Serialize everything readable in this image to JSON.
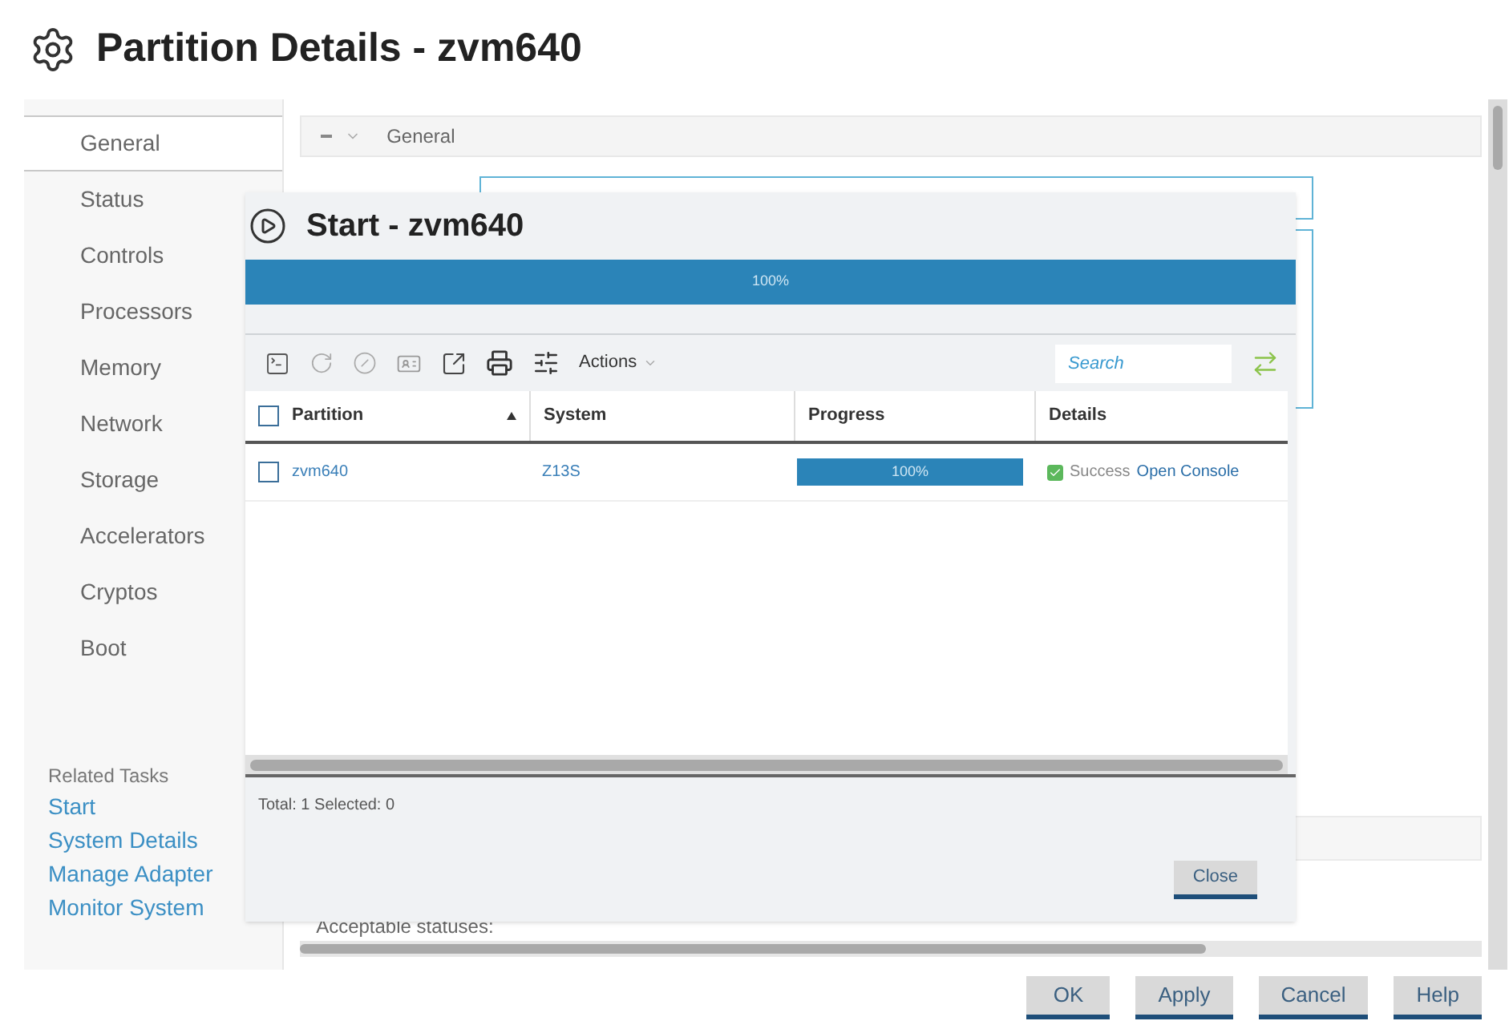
{
  "window": {
    "title": "Partition Details - zvm640"
  },
  "sidebar": {
    "items": [
      {
        "label": "General",
        "selected": true
      },
      {
        "label": "Status",
        "selected": false
      },
      {
        "label": "Controls",
        "selected": false
      },
      {
        "label": "Processors",
        "selected": false
      },
      {
        "label": "Memory",
        "selected": false
      },
      {
        "label": "Network",
        "selected": false
      },
      {
        "label": "Storage",
        "selected": false
      },
      {
        "label": "Accelerators",
        "selected": false
      },
      {
        "label": "Cryptos",
        "selected": false
      },
      {
        "label": "Boot",
        "selected": false
      }
    ],
    "related_tasks": {
      "heading": "Related Tasks",
      "links": [
        "Start",
        "System Details",
        "Manage Adapter",
        "Monitor System"
      ]
    }
  },
  "content": {
    "section": {
      "label": "General",
      "expanded": true
    },
    "acceptable_statuses_label": "Acceptable statuses:"
  },
  "dialog": {
    "title": "Start - zvm640",
    "progress": {
      "level": 1,
      "reading": "100%"
    },
    "toolbar": {
      "actions_label": "Actions",
      "search": {
        "placeholder": "Search"
      }
    },
    "table": {
      "header_checked": false,
      "columns": [
        {
          "label": "Partition",
          "sorted": true
        },
        {
          "label": "System",
          "sorted": false
        },
        {
          "label": "Progress",
          "sorted": false
        },
        {
          "label": "Details",
          "sorted": false
        }
      ],
      "rows": [
        {
          "checked": false,
          "partition": "zvm640",
          "system": "Z13S",
          "progress": {
            "level": 1,
            "reading": "100%"
          },
          "status": "Success",
          "link": "Open Console"
        }
      ]
    },
    "footer": {
      "summary": "Total: 1 Selected: 0"
    },
    "buttons": [
      "Close"
    ]
  },
  "buttons": [
    "OK",
    "Apply",
    "Cancel",
    "Help"
  ]
}
